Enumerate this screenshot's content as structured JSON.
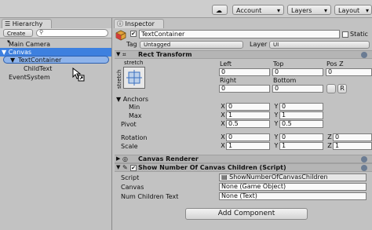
{
  "toolbar": {
    "account": "Account",
    "layers": "Layers",
    "layout": "Layout"
  },
  "hierarchy": {
    "tab": "Hierarchy",
    "create": "Create",
    "search_placeholder": "All",
    "items": [
      "Main Camera",
      "Canvas",
      "TextContainer",
      "ChildText",
      "EventSystem"
    ]
  },
  "inspector": {
    "tab": "Inspector",
    "object_name": "TextContainer",
    "static_label": "Static",
    "tag_label": "Tag",
    "tag_value": "Untagged",
    "layer_label": "Layer",
    "layer_value": "UI",
    "rect": {
      "title": "Rect Transform",
      "anchor_preset": "stretch",
      "col1": "Left",
      "col2": "Top",
      "col3": "Pos Z",
      "left": "0",
      "top": "0",
      "posz": "0",
      "right_label": "Right",
      "bottom_label": "Bottom",
      "right": "0",
      "bottom": "0",
      "anchors_label": "Anchors",
      "min_label": "Min",
      "min_x": "0",
      "min_y": "0",
      "max_label": "Max",
      "max_x": "1",
      "max_y": "1",
      "pivot_label": "Pivot",
      "pivot_x": "0.5",
      "pivot_y": "0.5",
      "rotation_label": "Rotation",
      "rot_x": "0",
      "rot_y": "0",
      "rot_z": "0",
      "scale_label": "Scale",
      "scale_x": "1",
      "scale_y": "1",
      "scale_z": "1",
      "axis_x": "X",
      "axis_y": "Y",
      "axis_z": "Z"
    },
    "canvas_renderer": "Canvas Renderer",
    "script": {
      "title": "Show Number Of Canvas Children (Script)",
      "script_label": "Script",
      "script_value": "ShowNumberOfCanvasChildren",
      "canvas_label": "Canvas",
      "canvas_value": "None (Game Object)",
      "numtext_label": "Num Children Text",
      "numtext_value": "None (Text)"
    },
    "add_component": "Add Component"
  }
}
